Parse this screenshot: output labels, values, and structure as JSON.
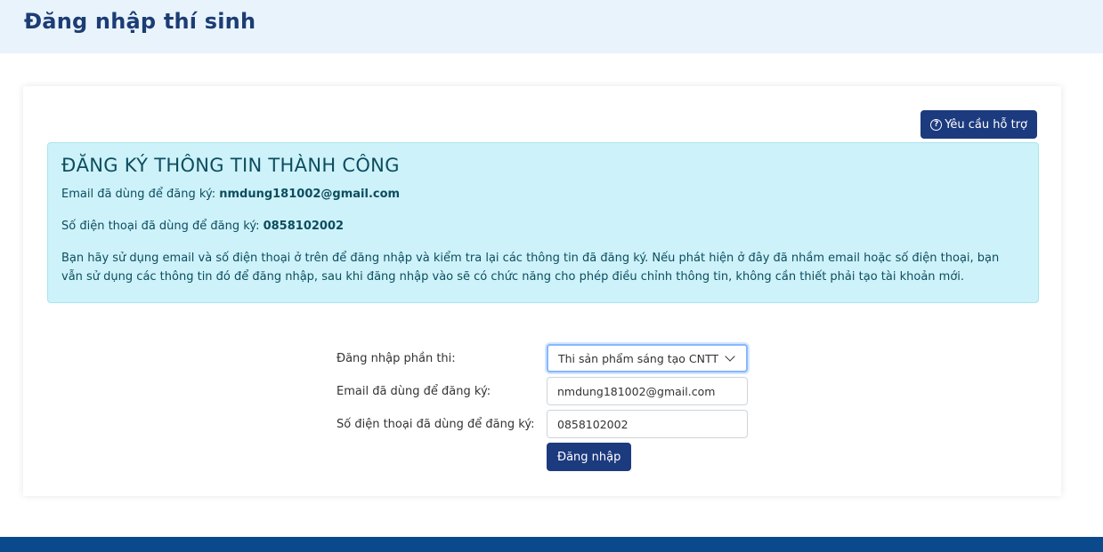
{
  "header": {
    "title": "Đăng nhập thí sinh"
  },
  "support": {
    "label": "Yêu cầu hỗ trợ",
    "icon": "help-circle-icon"
  },
  "alert": {
    "title": "ĐĂNG KÝ THÔNG TIN THÀNH CÔNG",
    "email_label": "Email đã dùng để đăng ký: ",
    "email_value": "nmdung181002@gmail.com",
    "phone_label": "Số điện thoại đã dùng để đăng ký: ",
    "phone_value": "0858102002",
    "note": "Bạn hãy sử dụng email và số điện thoại ở trên để đăng nhập và kiểm tra lại các thông tin đã đăng ký. Nếu phát hiện ở đây đã nhầm email hoặc số điện thoại, bạn vẫn sử dụng các thông tin đó để đăng nhập, sau khi đăng nhập vào sẽ có chức năng cho phép điều chỉnh thông tin, không cần thiết phải tạo tài khoản mới."
  },
  "form": {
    "section_label": "Đăng nhập phần thi:",
    "section_value": "Thi sản phẩm sáng tạo CNTT",
    "email_label": "Email đã dùng để đăng ký:",
    "email_value": "nmdung181002@gmail.com",
    "phone_label": "Số điện thoại đã dùng để đăng ký:",
    "phone_value": "0858102002",
    "submit_label": "Đăng nhập"
  },
  "colors": {
    "primary": "#1c3a7e",
    "header_bg": "#e8f3fc",
    "alert_bg": "#cdf2fa",
    "footer_bg": "#0a4a8c"
  }
}
